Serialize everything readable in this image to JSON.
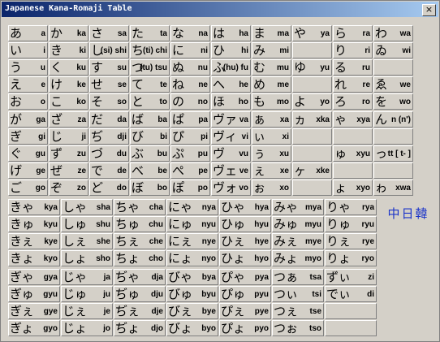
{
  "window": {
    "title": "Japanese Kana-Romaji Table",
    "close": "×"
  },
  "lang_button": "中日韓",
  "tables": [
    {
      "rows": [
        [
          [
            "あ",
            "a"
          ],
          [
            "か",
            "ka"
          ],
          [
            "さ",
            "sa"
          ],
          [
            "た",
            "ta"
          ],
          [
            "な",
            "na"
          ],
          [
            "は",
            "ha"
          ],
          [
            "ま",
            "ma"
          ],
          [
            "や",
            "ya"
          ],
          [
            "ら",
            "ra"
          ],
          [
            "わ",
            "wa"
          ]
        ],
        [
          [
            "い",
            "i"
          ],
          [
            "き",
            "ki"
          ],
          [
            "し",
            "(si) shi"
          ],
          [
            "ち",
            "(ti) chi"
          ],
          [
            "に",
            "ni"
          ],
          [
            "ひ",
            "hi"
          ],
          [
            "み",
            "mi"
          ],
          null,
          [
            "り",
            "ri"
          ],
          [
            "ゐ",
            "wi"
          ]
        ],
        [
          [
            "う",
            "u"
          ],
          [
            "く",
            "ku"
          ],
          [
            "す",
            "su"
          ],
          [
            "つ",
            "(tu) tsu"
          ],
          [
            "ぬ",
            "nu"
          ],
          [
            "ふ",
            "(hu) fu"
          ],
          [
            "む",
            "mu"
          ],
          [
            "ゆ",
            "yu"
          ],
          [
            "る",
            "ru"
          ],
          null
        ],
        [
          [
            "え",
            "e"
          ],
          [
            "け",
            "ke"
          ],
          [
            "せ",
            "se"
          ],
          [
            "て",
            "te"
          ],
          [
            "ね",
            "ne"
          ],
          [
            "へ",
            "he"
          ],
          [
            "め",
            "me"
          ],
          null,
          [
            "れ",
            "re"
          ],
          [
            "ゑ",
            "we"
          ]
        ],
        [
          [
            "お",
            "o"
          ],
          [
            "こ",
            "ko"
          ],
          [
            "そ",
            "so"
          ],
          [
            "と",
            "to"
          ],
          [
            "の",
            "no"
          ],
          [
            "ほ",
            "ho"
          ],
          [
            "も",
            "mo"
          ],
          [
            "よ",
            "yo"
          ],
          [
            "ろ",
            "ro"
          ],
          [
            "を",
            "wo"
          ]
        ]
      ]
    },
    {
      "rows": [
        [
          [
            "が",
            "ga"
          ],
          [
            "ざ",
            "za"
          ],
          [
            "だ",
            "da"
          ],
          [
            "ば",
            "ba"
          ],
          [
            "ぱ",
            "pa"
          ],
          [
            "ヴァ",
            "va"
          ],
          [
            "ぁ",
            "xa"
          ],
          [
            "ヵ",
            "xka"
          ],
          [
            "ゃ",
            "xya"
          ],
          [
            "ん",
            "n (n')"
          ]
        ],
        [
          [
            "ぎ",
            "gi"
          ],
          [
            "じ",
            "ji"
          ],
          [
            "ぢ",
            "dji"
          ],
          [
            "び",
            "bi"
          ],
          [
            "ぴ",
            "pi"
          ],
          [
            "ヴィ",
            "vi"
          ],
          [
            "ぃ",
            "xi"
          ],
          null,
          null,
          null
        ],
        [
          [
            "ぐ",
            "gu"
          ],
          [
            "ず",
            "zu"
          ],
          [
            "づ",
            "du"
          ],
          [
            "ぶ",
            "bu"
          ],
          [
            "ぷ",
            "pu"
          ],
          [
            "ヴ",
            "vu"
          ],
          [
            "ぅ",
            "xu"
          ],
          null,
          [
            "ゅ",
            "xyu"
          ],
          [
            "っ",
            "tt [ t- ]"
          ]
        ],
        [
          [
            "げ",
            "ge"
          ],
          [
            "ぜ",
            "ze"
          ],
          [
            "で",
            "de"
          ],
          [
            "べ",
            "be"
          ],
          [
            "ぺ",
            "pe"
          ],
          [
            "ヴェ",
            "ve"
          ],
          [
            "ぇ",
            "xe"
          ],
          [
            "ヶ",
            "xke"
          ],
          null,
          null
        ],
        [
          [
            "ご",
            "go"
          ],
          [
            "ぞ",
            "zo"
          ],
          [
            "ど",
            "do"
          ],
          [
            "ぼ",
            "bo"
          ],
          [
            "ぽ",
            "po"
          ],
          [
            "ヴォ",
            "vo"
          ],
          [
            "ぉ",
            "xo"
          ],
          null,
          [
            "ょ",
            "xyo"
          ],
          [
            "ゎ",
            "xwa"
          ]
        ]
      ]
    },
    {
      "rows": [
        [
          [
            "きゃ",
            "kya"
          ],
          [
            "しゃ",
            "sha"
          ],
          [
            "ちゃ",
            "cha"
          ],
          [
            "にゃ",
            "nya"
          ],
          [
            "ひゃ",
            "hya"
          ],
          [
            "みゃ",
            "mya"
          ],
          [
            "りゃ",
            "rya"
          ]
        ],
        [
          [
            "きゅ",
            "kyu"
          ],
          [
            "しゅ",
            "shu"
          ],
          [
            "ちゅ",
            "chu"
          ],
          [
            "にゅ",
            "nyu"
          ],
          [
            "ひゅ",
            "hyu"
          ],
          [
            "みゅ",
            "myu"
          ],
          [
            "りゅ",
            "ryu"
          ]
        ],
        [
          [
            "きぇ",
            "kye"
          ],
          [
            "しぇ",
            "she"
          ],
          [
            "ちぇ",
            "che"
          ],
          [
            "にぇ",
            "nye"
          ],
          [
            "ひぇ",
            "hye"
          ],
          [
            "みぇ",
            "mye"
          ],
          [
            "りぇ",
            "rye"
          ]
        ],
        [
          [
            "きょ",
            "kyo"
          ],
          [
            "しょ",
            "sho"
          ],
          [
            "ちょ",
            "cho"
          ],
          [
            "にょ",
            "nyo"
          ],
          [
            "ひょ",
            "hyo"
          ],
          [
            "みょ",
            "myo"
          ],
          [
            "りょ",
            "ryo"
          ]
        ]
      ]
    },
    {
      "rows": [
        [
          [
            "ぎゃ",
            "gya"
          ],
          [
            "じゃ",
            "ja"
          ],
          [
            "ぢゃ",
            "dja"
          ],
          [
            "びゃ",
            "bya"
          ],
          [
            "ぴゃ",
            "pya"
          ],
          [
            "つぁ",
            "tsa"
          ],
          [
            "ずぃ",
            "zi"
          ]
        ],
        [
          [
            "ぎゅ",
            "gyu"
          ],
          [
            "じゅ",
            "ju"
          ],
          [
            "ぢゅ",
            "dju"
          ],
          [
            "びゅ",
            "byu"
          ],
          [
            "ぴゅ",
            "pyu"
          ],
          [
            "つぃ",
            "tsi"
          ],
          [
            "でぃ",
            "di"
          ]
        ],
        [
          [
            "ぎぇ",
            "gye"
          ],
          [
            "じぇ",
            "je"
          ],
          [
            "ぢぇ",
            "dje"
          ],
          [
            "びぇ",
            "bye"
          ],
          [
            "ぴぇ",
            "pye"
          ],
          [
            "つぇ",
            "tse"
          ],
          null
        ],
        [
          [
            "ぎょ",
            "gyo"
          ],
          [
            "じょ",
            "jo"
          ],
          [
            "ぢょ",
            "djo"
          ],
          [
            "びょ",
            "byo"
          ],
          [
            "ぴょ",
            "pyo"
          ],
          [
            "つぉ",
            "tso"
          ],
          null
        ]
      ]
    }
  ]
}
